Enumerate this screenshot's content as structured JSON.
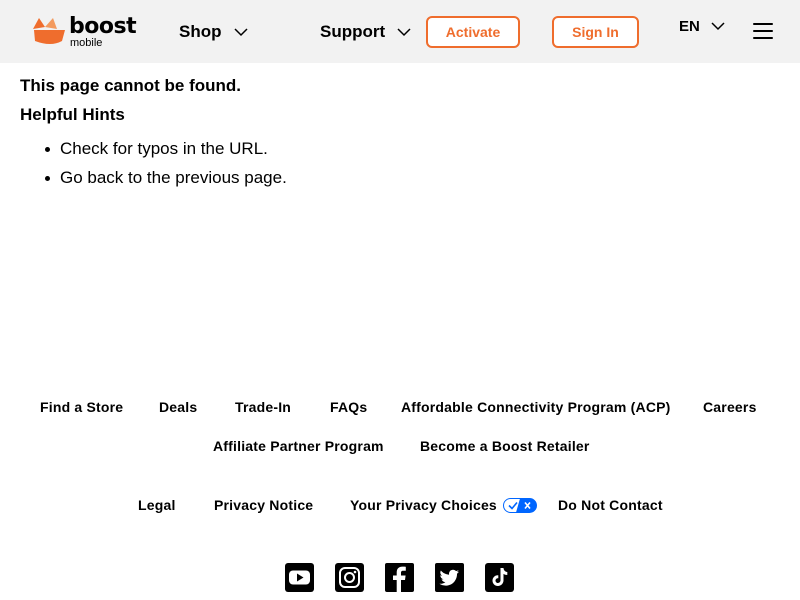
{
  "header": {
    "logo": {
      "word": "boost",
      "sub": "mobile"
    },
    "nav": [
      {
        "label": "Shop"
      },
      {
        "label": "Support"
      }
    ],
    "activate_label": "Activate",
    "signin_label": "Sign In",
    "language": "EN",
    "colors": {
      "background": "#f2f2f2",
      "accent": "#ef6d2d"
    }
  },
  "main": {
    "title": "This page cannot be found.",
    "hints_heading": "Helpful Hints",
    "hints": [
      "Check for typos in the URL.",
      "Go back to the previous page."
    ]
  },
  "footer": {
    "links_row1": [
      "Find a Store",
      "Deals",
      "Trade-In",
      "FAQs",
      "Affordable Connectivity Program (ACP)",
      "Careers"
    ],
    "links_row2": [
      "Affiliate Partner Program",
      "Become a Boost Retailer"
    ],
    "legal_links": [
      "Legal",
      "Privacy Notice",
      "Your Privacy Choices",
      "Do Not Contact"
    ],
    "social_icons": [
      "youtube-icon",
      "instagram-icon",
      "facebook-icon",
      "twitter-icon",
      "tiktok-icon"
    ]
  }
}
